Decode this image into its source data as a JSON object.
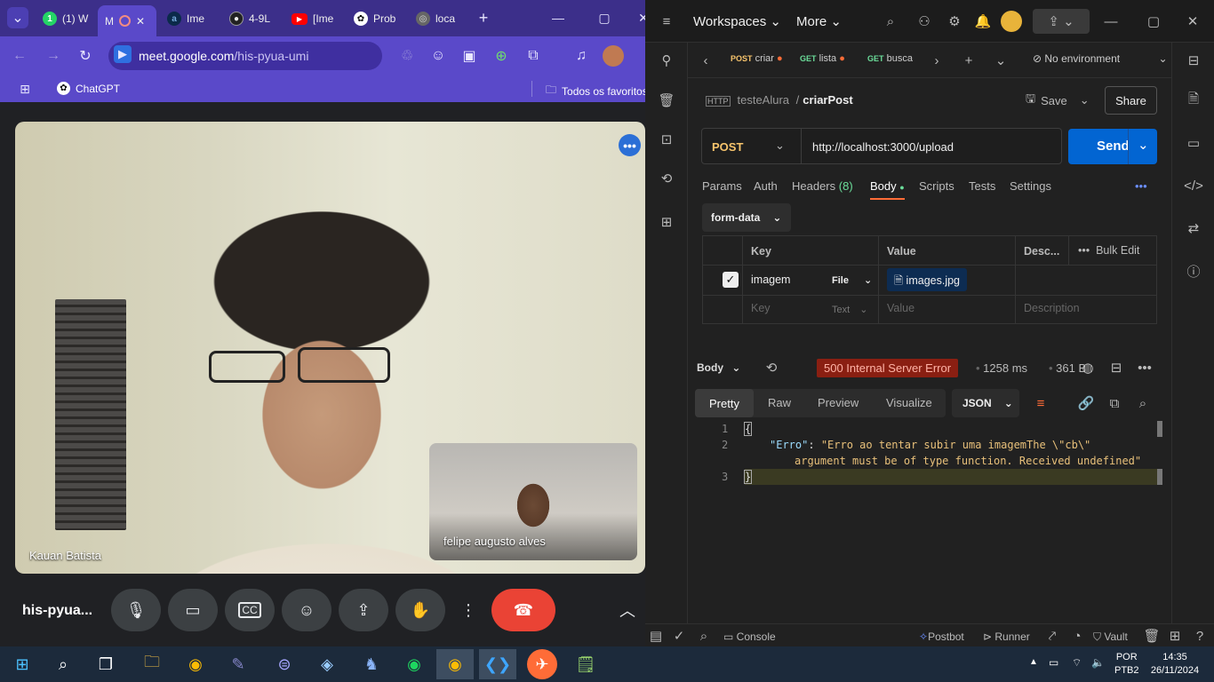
{
  "chrome": {
    "tabs": [
      {
        "icon": "whatsapp-icon",
        "label": "(1) W"
      },
      {
        "icon": "meet-icon",
        "label": "M"
      },
      {
        "icon": "alura-icon",
        "label": "Ime"
      },
      {
        "icon": "github-icon",
        "label": "4-9L"
      },
      {
        "icon": "youtube-icon",
        "label": "[Ime"
      },
      {
        "icon": "chatgpt-icon",
        "label": "Prob"
      },
      {
        "icon": "globe-icon",
        "label": "loca"
      }
    ],
    "new_tab": "+",
    "url_host": "meet.google.com",
    "url_path": "/his-pyua-umi",
    "bookmarks": {
      "chatgpt": "ChatGPT",
      "all_bookmarks": "Todos os favoritos"
    }
  },
  "meet": {
    "main_participant": "Kauan Batista",
    "pip_participant": "felipe augusto alves",
    "meeting_code": "his-pyua..."
  },
  "postman": {
    "workspaces": "Workspaces",
    "more": "More",
    "tabs": [
      {
        "method": "POST",
        "name": "criar"
      },
      {
        "method": "GET",
        "name": "lista"
      },
      {
        "method": "GET",
        "name": "busca"
      }
    ],
    "environment": "No environment",
    "breadcrumb_parent": "testeAlura",
    "breadcrumb_sep": "/",
    "request_name": "criarPost",
    "save": "Save",
    "share": "Share",
    "method": "POST",
    "url": "http://localhost:3000/upload",
    "send": "Send",
    "subtabs": [
      "Params",
      "Auth",
      "Headers",
      "(8)",
      "Body",
      "Scripts",
      "Tests",
      "Settings"
    ],
    "body_mode": "form-data",
    "table": {
      "col_key": "Key",
      "col_value": "Value",
      "col_desc": "Desc...",
      "bulk_edit": "Bulk Edit",
      "row1_key": "imagem",
      "row1_type": "File",
      "row1_value": "images.jpg",
      "row2_key": "Key",
      "row2_type": "Text",
      "row2_value": "Value",
      "row2_desc": "Description"
    },
    "response": {
      "label": "Body",
      "status": "500 Internal Server Error",
      "time": "1258 ms",
      "size": "361 B",
      "views": [
        "Pretty",
        "Raw",
        "Preview",
        "Visualize"
      ],
      "format": "JSON",
      "lines": [
        "1",
        "2",
        "3"
      ],
      "line1": "{",
      "json_key": "\"Erro\"",
      "json_colon": ":",
      "json_value_a": "\"Erro ao tentar subir uma imagemThe \\\"cb\\\"",
      "json_value_b": "argument must be of type function. Received undefined\"",
      "line3": "}"
    },
    "footer": {
      "console": "Console",
      "postbot": "Postbot",
      "runner": "Runner",
      "vault": "Vault"
    },
    "colors": {
      "send": "#0265d2",
      "status_error_bg": "#8a1f12",
      "status_error_text": "#ffb3a6",
      "orange": "#ff6c37"
    }
  },
  "taskbar": {
    "lang": "POR",
    "layout": "PTB2",
    "time": "14:35",
    "date": "26/11/2024"
  }
}
